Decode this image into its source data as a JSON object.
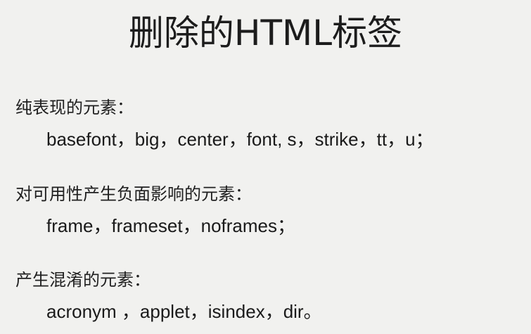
{
  "title": "删除的HTML标签",
  "sections": [
    {
      "heading": "纯表现的元素：",
      "items": "basefont，big，center，font, s，strike，tt，u；"
    },
    {
      "heading": "对可用性产生负面影响的元素：",
      "items": "frame，frameset，noframes；"
    },
    {
      "heading": "产生混淆的元素：",
      "items": "acronym ，applet，isindex，dir。"
    }
  ]
}
